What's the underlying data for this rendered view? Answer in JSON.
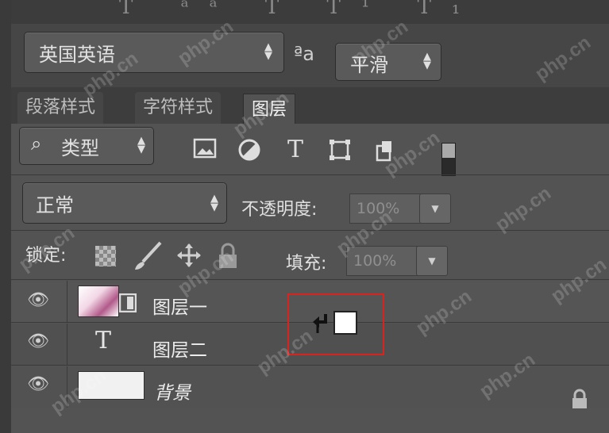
{
  "top_toolbar": {
    "partial_glyphs": "T  ᵃᵃ  T  T¹  T₁"
  },
  "character": {
    "language": "英国英语",
    "aa_icon": "ªa",
    "antialias": "平滑"
  },
  "tabs": [
    {
      "label": "段落样式"
    },
    {
      "label": "字符样式"
    },
    {
      "label": "图层"
    }
  ],
  "filter": {
    "kind_label": "类型",
    "search_icon": "⌕",
    "icons": [
      "image-filter-icon",
      "adjustment-filter-icon",
      "type-filter-icon",
      "shape-filter-icon",
      "smart-object-filter-icon"
    ]
  },
  "blend": {
    "mode": "正常",
    "opacity_label": "不透明度:",
    "opacity_value": "100%"
  },
  "lock": {
    "label": "锁定:",
    "fill_label": "填充:",
    "fill_value": "100%"
  },
  "layers": [
    {
      "name": "图层一",
      "type": "smart-object"
    },
    {
      "name": "图层二",
      "type": "text"
    },
    {
      "name": "背景",
      "type": "background"
    }
  ],
  "watermark": "php.cn"
}
